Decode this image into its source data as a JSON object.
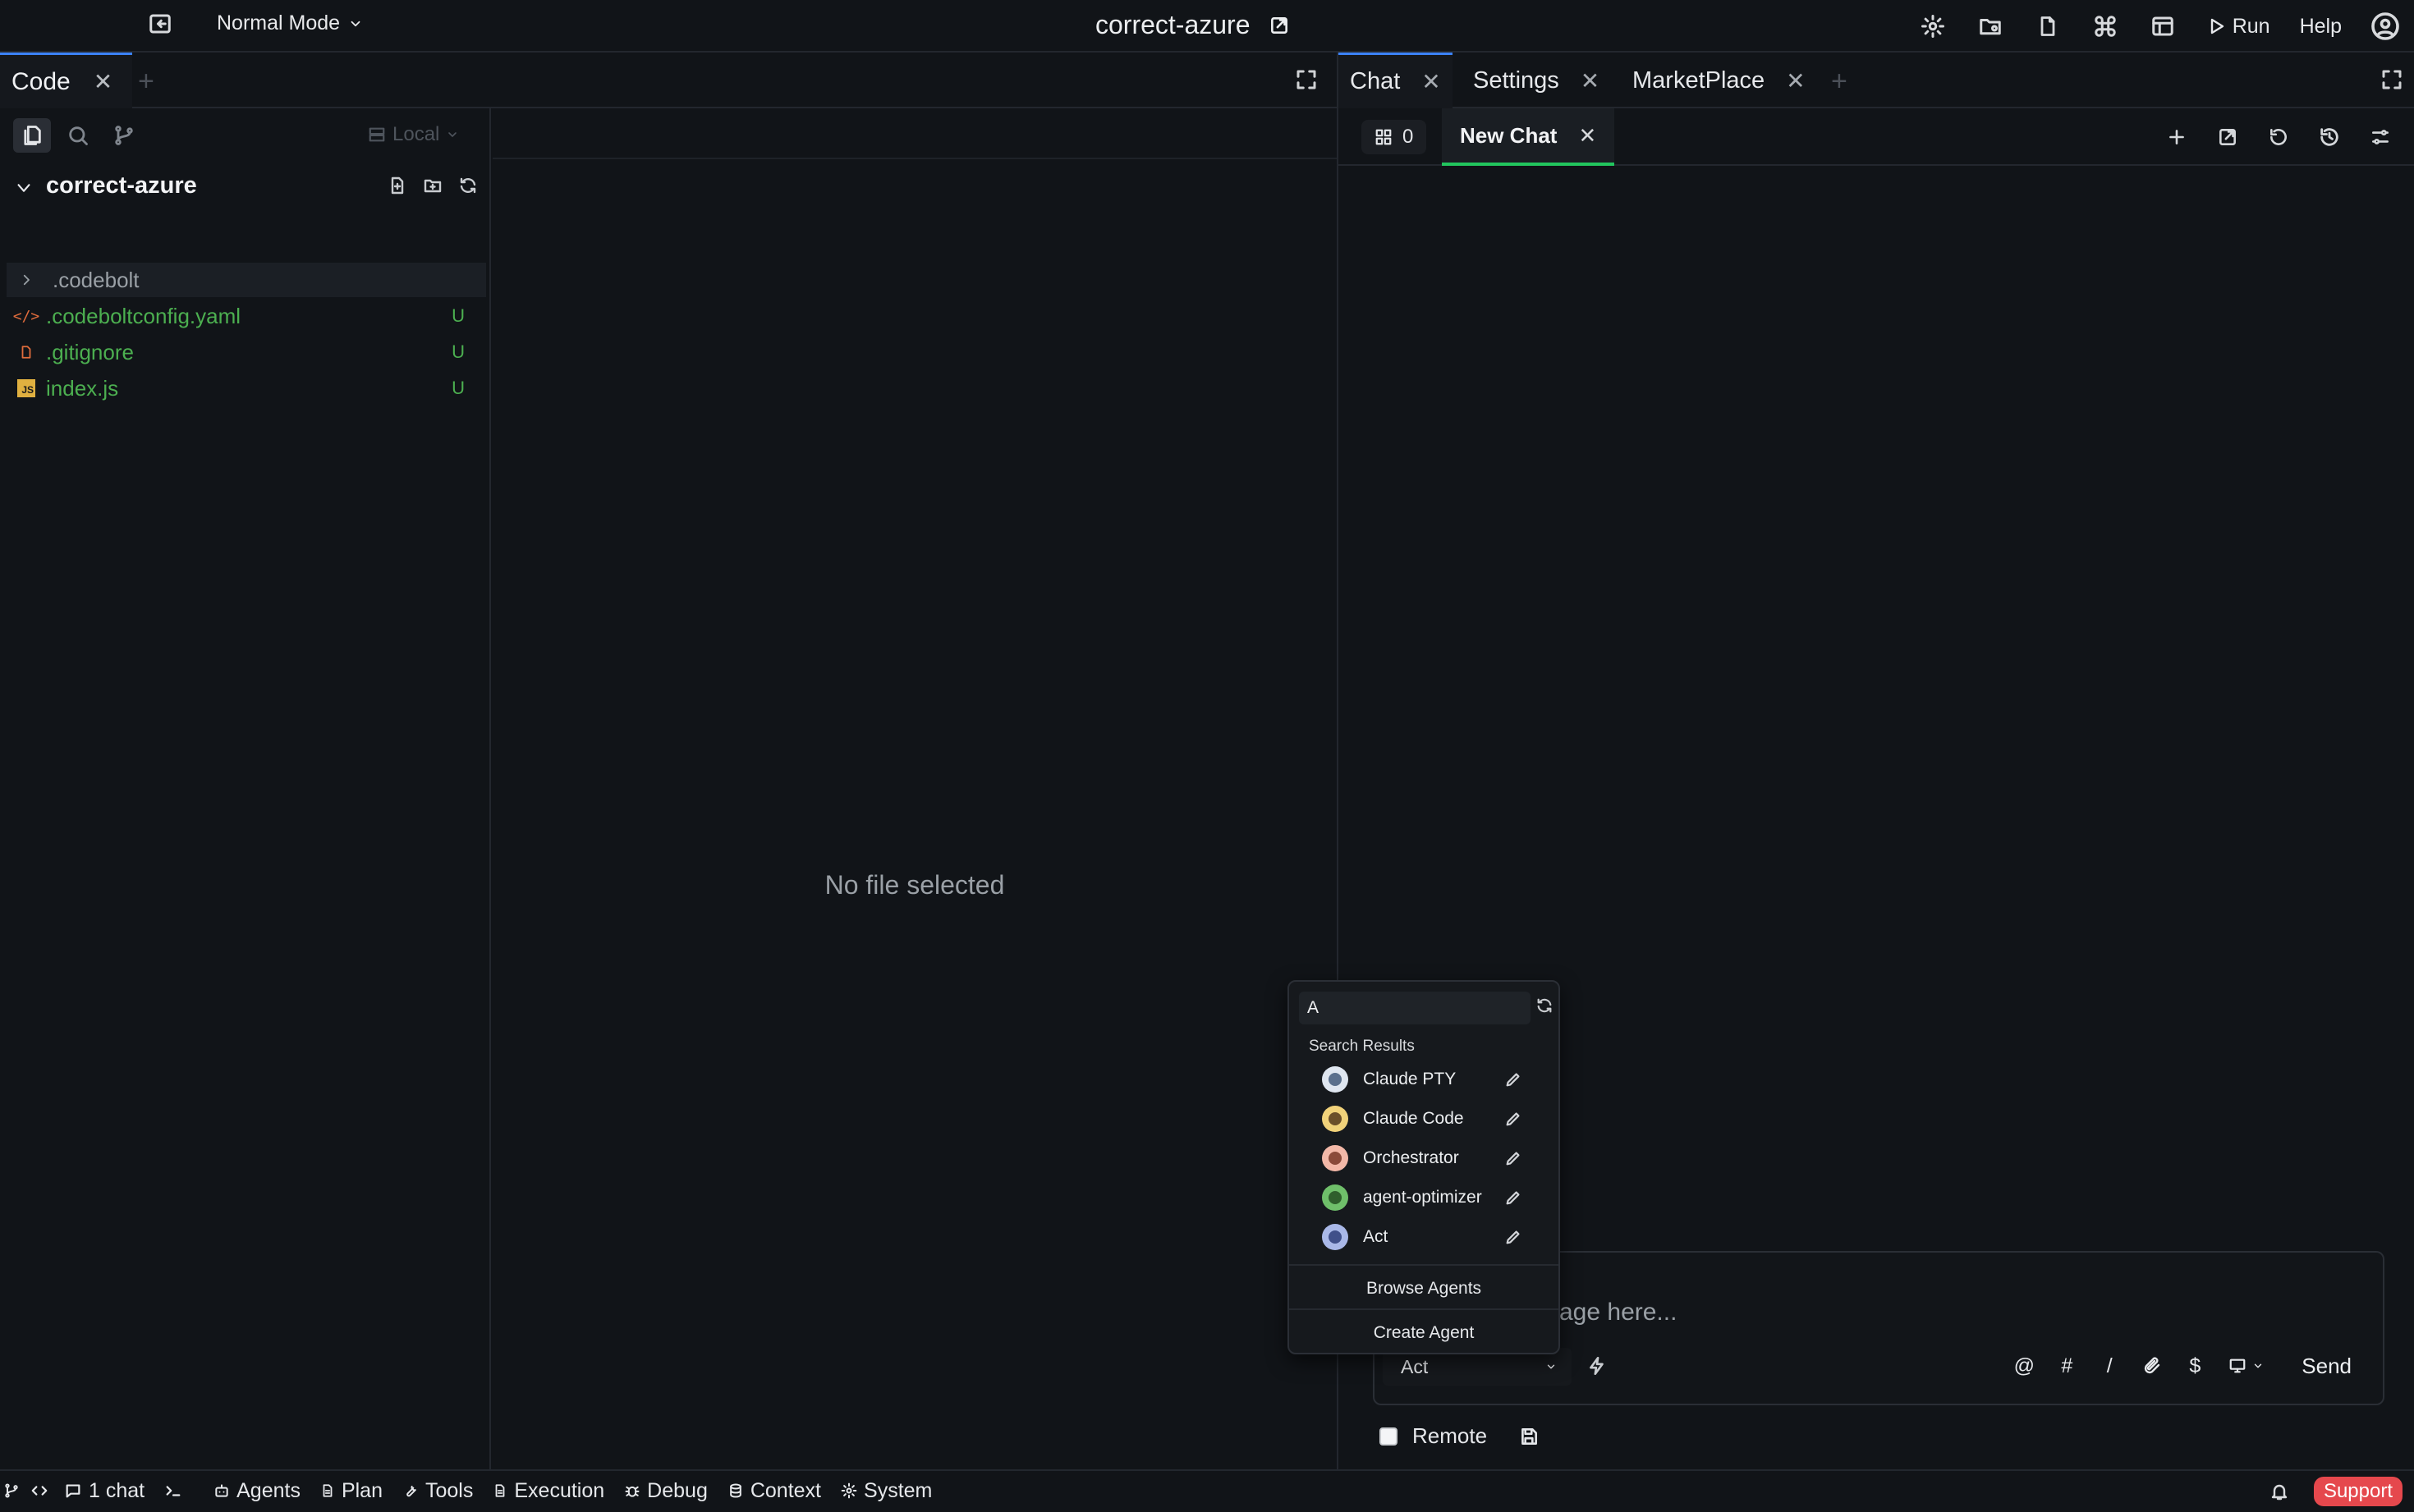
{
  "topbar": {
    "mode": "Normal Mode",
    "project_title": "correct-azure",
    "run_label": "Run",
    "help_label": "Help"
  },
  "left_panel": {
    "tab_label": "Code",
    "local_label": "Local",
    "project_name": "correct-azure",
    "files": [
      {
        "name": ".codebolt",
        "status": "",
        "color": "#9aa0a6"
      },
      {
        "name": ".codeboltconfig.yaml",
        "status": "U",
        "color": "#4caf50"
      },
      {
        "name": ".gitignore",
        "status": "U",
        "color": "#4caf50"
      },
      {
        "name": "index.js",
        "status": "U",
        "color": "#4caf50"
      }
    ],
    "empty_editor": "No file selected"
  },
  "right_panel": {
    "tabs": [
      "Chat",
      "Settings",
      "MarketPlace"
    ],
    "context_count": "0",
    "chat_tab": "New Chat",
    "composer_placeholder_visible": "sage here...",
    "agent_selected": "Act",
    "send_label": "Send",
    "remote_label": "Remote",
    "tool_symbols": {
      "mention": "@",
      "hash": "#",
      "slash": "/",
      "dollar": "$"
    }
  },
  "agent_popup": {
    "search_value": "A",
    "heading": "Search Results",
    "agents": [
      "Claude PTY",
      "Claude Code",
      "Orchestrator",
      "agent-optimizer",
      "Act"
    ],
    "browse_label": "Browse Agents",
    "create_label": "Create Agent"
  },
  "statusbar": {
    "chat_count": "1 chat",
    "items": [
      "Agents",
      "Plan",
      "Tools",
      "Execution",
      "Debug",
      "Context",
      "System"
    ],
    "support_label": "Support"
  },
  "colors": {
    "accent_blue": "#3b82f6",
    "accent_green": "#22c55e",
    "untracked_green": "#4caf50",
    "support_red": "#e5484d"
  }
}
